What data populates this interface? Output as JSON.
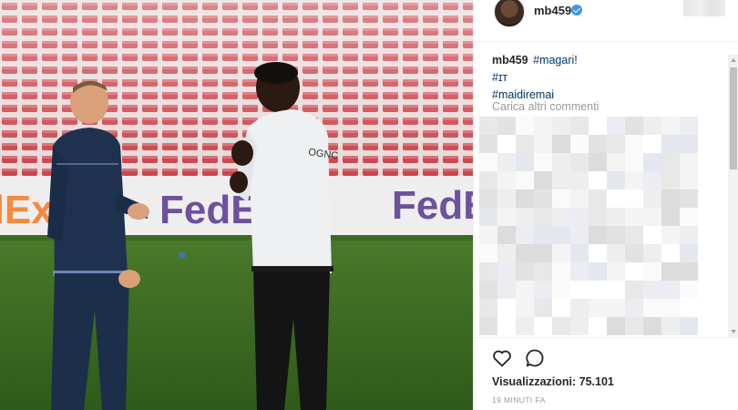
{
  "post": {
    "username": "mb459",
    "verified": true
  },
  "caption": {
    "author": "mb459",
    "line1_tag": "#magari!",
    "line2_text": "#ɪᴛ",
    "line3_tag": "#maidiremai"
  },
  "comments": {
    "load_more_label": "Carica altri commenti"
  },
  "stats": {
    "views_label": "Visualizzazioni:",
    "views_count": "75.101",
    "timestamp": "19 MINUTI FA"
  },
  "icons": {
    "like": "heart-icon",
    "comment": "comment-bubble-icon",
    "verified": "verified-badge-icon"
  },
  "colors": {
    "accent": "#3897f0",
    "hashtag": "#003569",
    "muted": "#999999"
  }
}
